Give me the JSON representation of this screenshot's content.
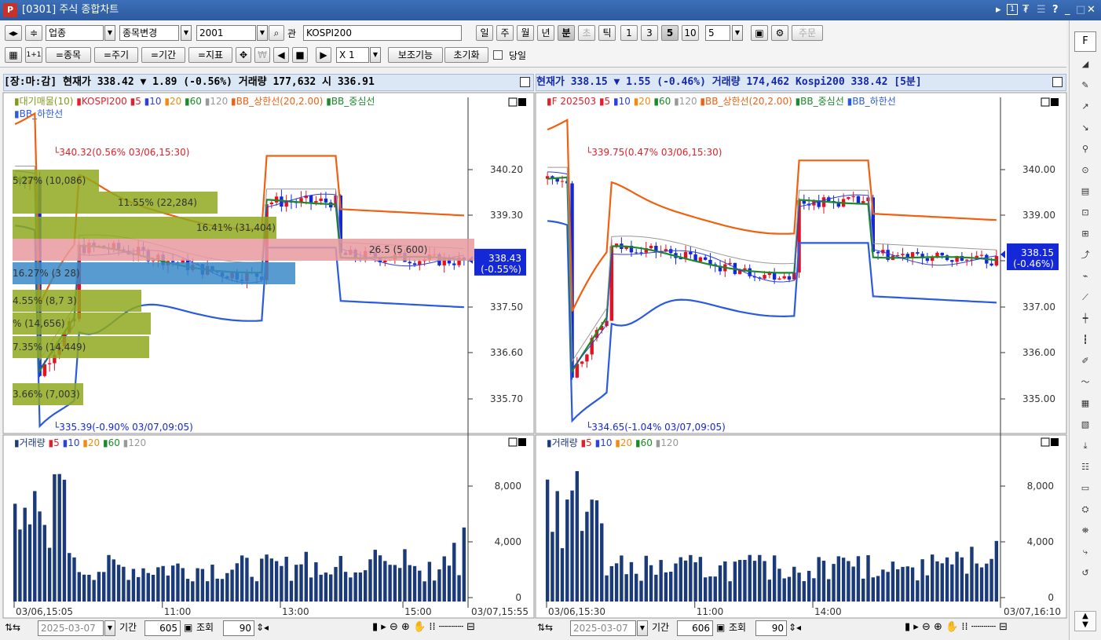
{
  "window": {
    "title": "[0301] 주식 종합차트",
    "logo": "P",
    "controls": [
      "▸",
      "1",
      "₮",
      "☰",
      "?",
      "_",
      "□",
      "×"
    ]
  },
  "toolbar": {
    "row1": {
      "nav": "◂▸",
      "updown": "≑",
      "industry": "업종",
      "change_label": "종목변경",
      "code": "2001",
      "pan_label": "관",
      "name": "KOSPI200",
      "periods": [
        "일",
        "주",
        "월",
        "년",
        "분",
        "초",
        "틱"
      ],
      "period_selected": "분",
      "period_disabled": "초",
      "intervals": [
        "1",
        "3",
        "5",
        "10"
      ],
      "interval_selected": "5",
      "interval_value": "5",
      "order_label": "주문"
    },
    "row2": {
      "grid": "▦",
      "oneone": "1+1",
      "stock": "=종목",
      "cycle": "=주기",
      "period": "=기간",
      "indicator": "=지표",
      "multiply": "X 1",
      "aux": "보조기능",
      "reset": "초기화",
      "today": "당일"
    }
  },
  "left": {
    "pricebar": "[장:마:감] 현재가    338.42  ▼    1.89 (-0.56%)  거래량 177,632  시 336.91",
    "legend": [
      {
        "t": "▮대기매물(10)",
        "c": "#7f9a1a"
      },
      {
        "t": "▮KOSPI200",
        "c": "#e0202a"
      },
      {
        "t": "▮5",
        "c": "#e0202a"
      },
      {
        "t": "▮10",
        "c": "#2a3fe0"
      },
      {
        "t": "▮20",
        "c": "#f08a10"
      },
      {
        "t": "▮60",
        "c": "#1a8a2a"
      },
      {
        "t": "▮120",
        "c": "#999999"
      },
      {
        "t": "▮BB_상한선(20,2.00)",
        "c": "#f06010"
      },
      {
        "t": "▮BB_중심선",
        "c": "#1a8a2a"
      }
    ],
    "legend2": [
      {
        "t": "▮BB_하한선",
        "c": "#2a5ae0"
      }
    ],
    "yticks": [
      "340.20",
      "339.30",
      "338.40",
      "337.50",
      "336.60",
      "335.70"
    ],
    "last_label": "338.43",
    "last_pct": "(-0.55%)",
    "high_ann": "340.32(0.56% 03/06,15:30)",
    "low_ann": "335.39(-0.90% 03/07,09:05)",
    "profile": [
      "5.27% (10,086)",
      "11.55% (22,284)",
      "16.41% (31,404)",
      "26.5 (5 600)",
      "16.27% (3 28)",
      "4.55% (8,7 3)",
      "% (14,656)",
      "7.35% (14,449)",
      "3.66% (7,003)"
    ],
    "vol_legend": [
      {
        "t": "▮거래량",
        "c": "#1a3a7a"
      },
      {
        "t": "▮5",
        "c": "#e0202a"
      },
      {
        "t": "▮10",
        "c": "#2a3fe0"
      },
      {
        "t": "▮20",
        "c": "#f08a10"
      },
      {
        "t": "▮60",
        "c": "#1a8a2a"
      },
      {
        "t": "▮120",
        "c": "#999999"
      }
    ],
    "vol_yticks": [
      "8,000",
      "4,000",
      "0"
    ],
    "xticks": [
      "03/06,15:05",
      "11:00",
      "13:00",
      "15:00"
    ],
    "xend": "03/07,15:55",
    "bottom": {
      "date": "2025-03-07",
      "period_label": "기간",
      "period": "605",
      "query": "조회",
      "zoom": "90"
    }
  },
  "right": {
    "pricebar": "현재가       338.15  ▼    1.55 (-0.46%)  거래량 174,462  Kospi200 338.42   [5분]",
    "legend": [
      {
        "t": "▮F 202503",
        "c": "#e0202a"
      },
      {
        "t": "▮5",
        "c": "#e0202a"
      },
      {
        "t": "▮10",
        "c": "#2a3fe0"
      },
      {
        "t": "▮20",
        "c": "#f08a10"
      },
      {
        "t": "▮60",
        "c": "#1a8a2a"
      },
      {
        "t": "▮120",
        "c": "#999999"
      },
      {
        "t": "▮BB_상한선(20,2.00)",
        "c": "#f06010"
      },
      {
        "t": "▮BB_중심선",
        "c": "#1a8a2a"
      },
      {
        "t": "▮BB_하한선",
        "c": "#2a5ae0"
      }
    ],
    "yticks": [
      "340.00",
      "339.00",
      "338.00",
      "337.00",
      "336.00",
      "335.00"
    ],
    "last_label": "338.15",
    "last_pct": "(-0.46%)",
    "high_ann": "339.75(0.47% 03/06,15:30)",
    "low_ann": "334.65(-1.04% 03/07,09:05)",
    "vol_legend": [
      {
        "t": "▮거래량",
        "c": "#1a3a7a"
      },
      {
        "t": "▮5",
        "c": "#e0202a"
      },
      {
        "t": "▮10",
        "c": "#2a3fe0"
      },
      {
        "t": "▮20",
        "c": "#f08a10"
      },
      {
        "t": "▮60",
        "c": "#1a8a2a"
      },
      {
        "t": "▮120",
        "c": "#999999"
      }
    ],
    "vol_yticks": [
      "8,000",
      "4,000",
      "0"
    ],
    "xticks": [
      "03/06,15:30",
      "11:00",
      "14:00"
    ],
    "xend": "03/07,16:10",
    "bottom": {
      "date": "2025-03-07",
      "period_label": "기간",
      "period": "606",
      "query": "조회",
      "zoom": "90"
    }
  },
  "sidebar": {
    "top_label": "F",
    "icons": [
      "chart-icon",
      "tools-icon",
      "price-icon",
      "trade-icon",
      "indicator-icon",
      "search-icon",
      "list-icon",
      "zoom-icon",
      "zoom2-icon",
      "trend-icon",
      "auto-icon",
      "line-icon",
      "candle-icon",
      "bar-icon",
      "draw-icon",
      "wave-icon",
      "box-icon",
      "box2-icon",
      "down-icon",
      "grid-icon",
      "window-icon",
      "order-icon",
      "order2-icon",
      "export-icon",
      "refresh-icon"
    ]
  },
  "colors": {
    "up": "#e8101e",
    "down": "#1428d8",
    "vol": "#1a3a7a"
  }
}
